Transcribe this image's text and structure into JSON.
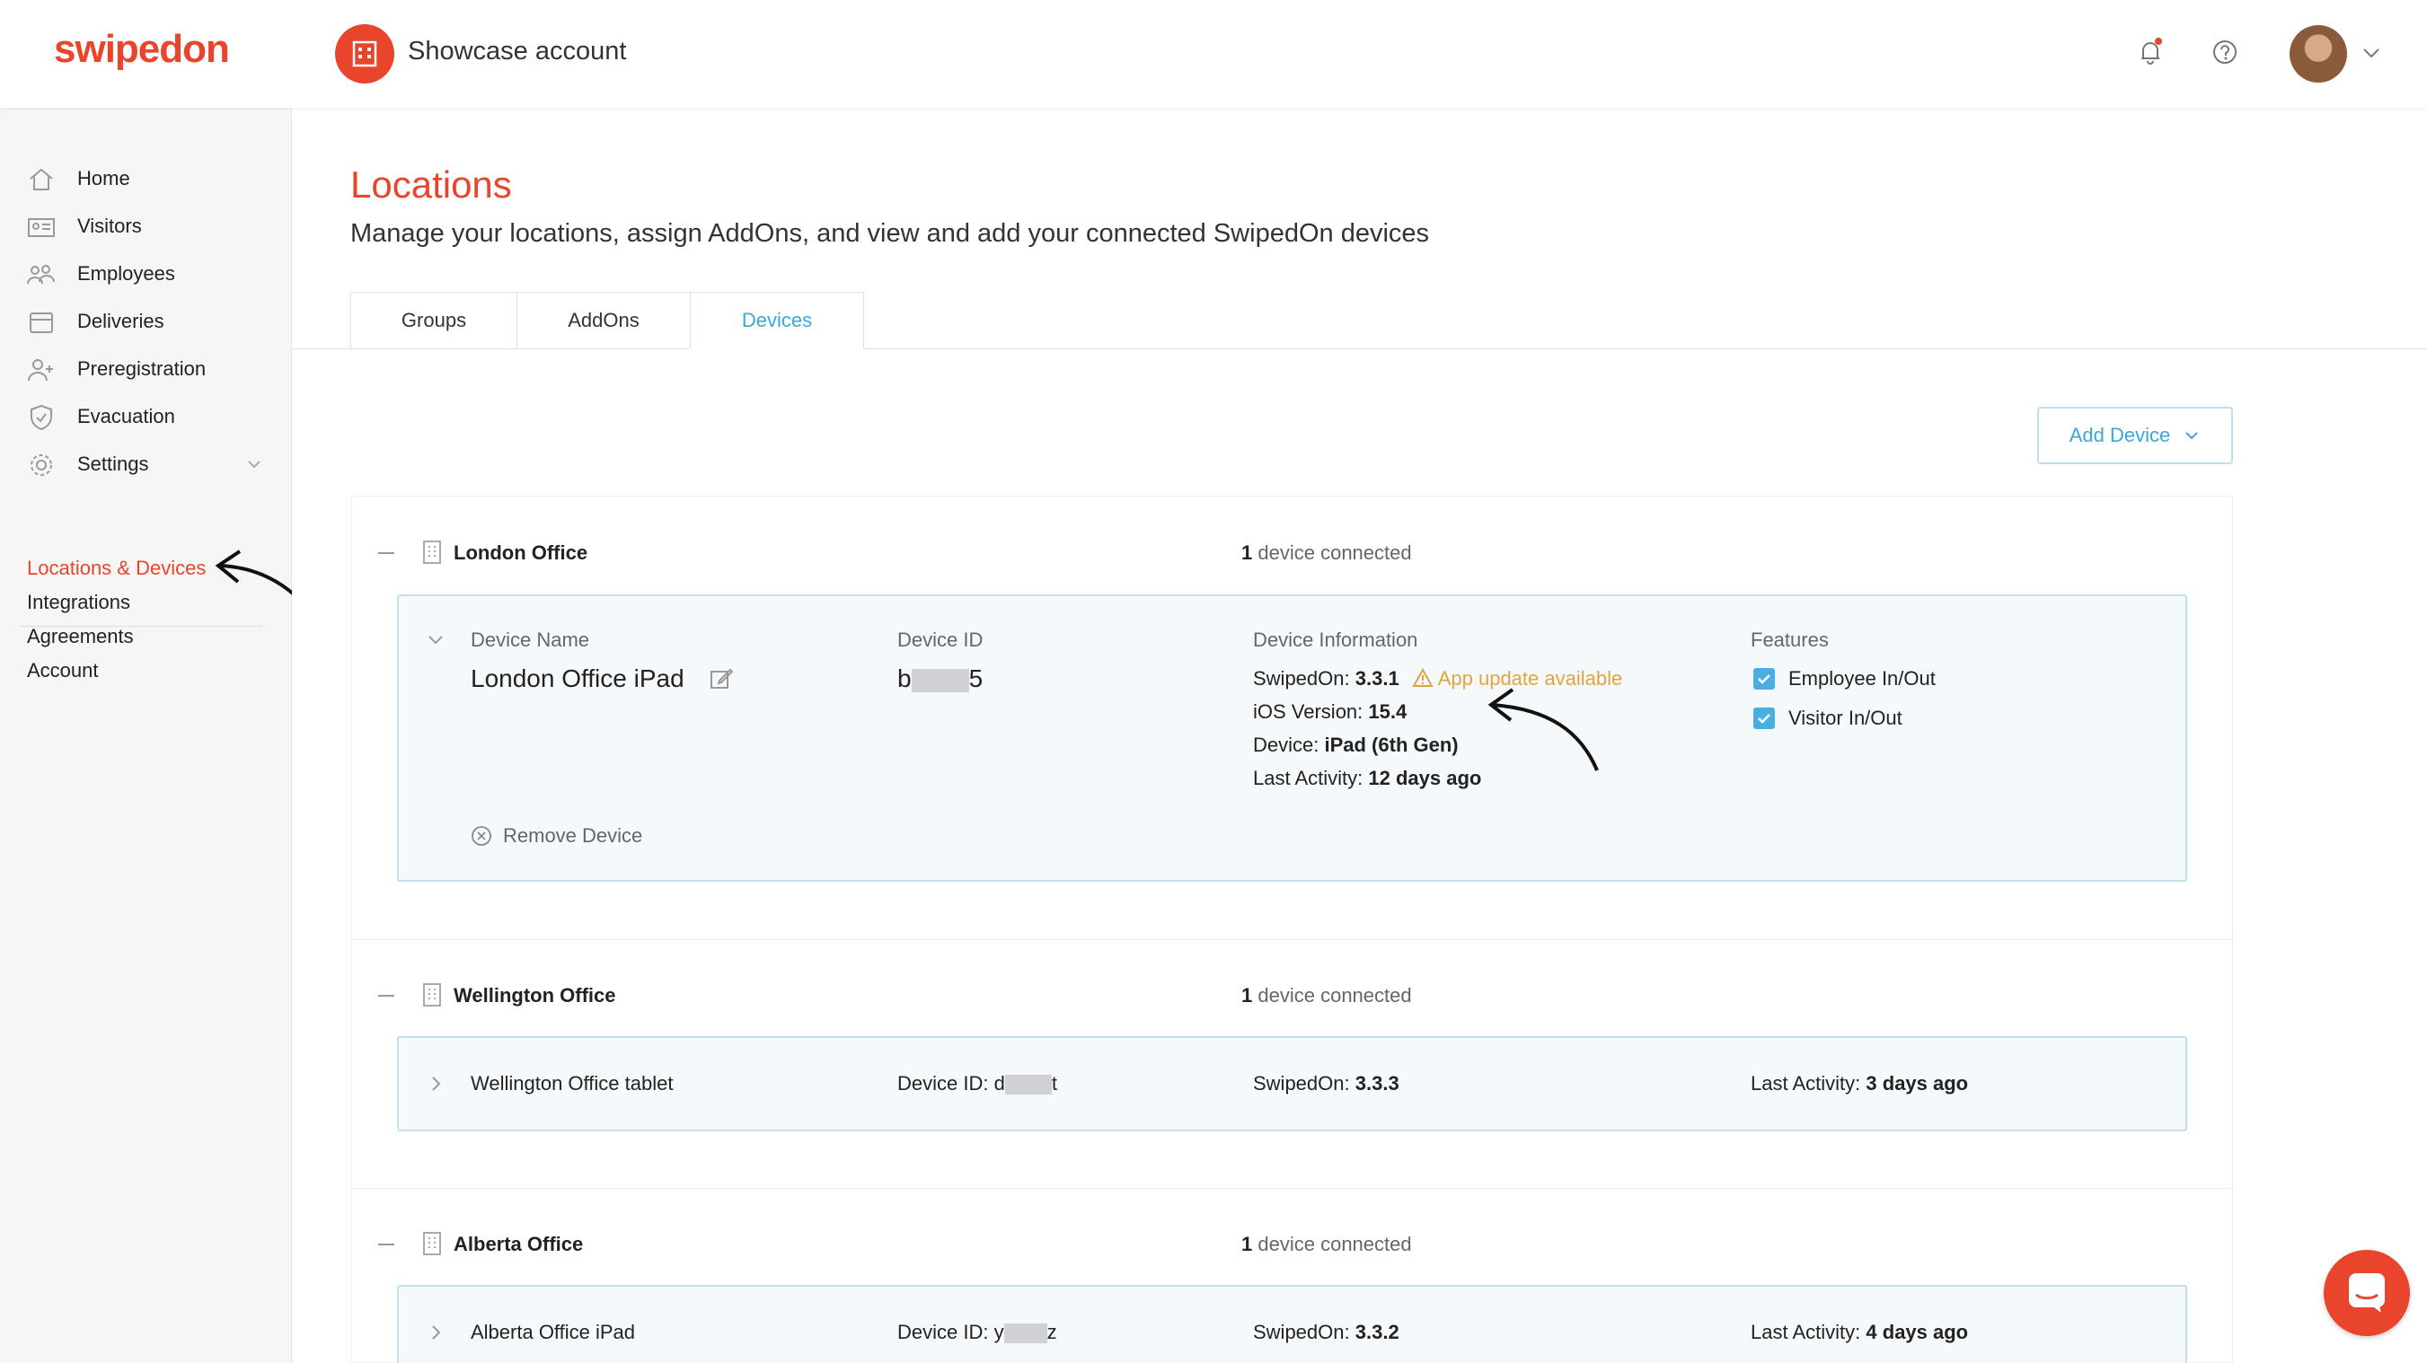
{
  "header": {
    "logo": "swipedon",
    "account_name": "Showcase account"
  },
  "sidebar": {
    "items": [
      {
        "label": "Home",
        "icon": "home-icon"
      },
      {
        "label": "Visitors",
        "icon": "id-card-icon"
      },
      {
        "label": "Employees",
        "icon": "people-icon"
      },
      {
        "label": "Deliveries",
        "icon": "box-icon"
      },
      {
        "label": "Preregistration",
        "icon": "user-plus-icon"
      },
      {
        "label": "Evacuation",
        "icon": "shield-icon"
      },
      {
        "label": "Settings",
        "icon": "gear-icon"
      }
    ],
    "links": [
      {
        "label": "Locations & Devices",
        "active": true
      },
      {
        "label": "Integrations"
      },
      {
        "label": "Agreements"
      },
      {
        "label": "Account"
      }
    ]
  },
  "page": {
    "title": "Locations",
    "subtitle": "Manage your locations, assign AddOns, and view and add your connected SwipedOn devices",
    "tabs": [
      "Groups",
      "AddOns",
      "Devices"
    ],
    "active_tab": "Devices",
    "add_device_label": "Add Device"
  },
  "locations": [
    {
      "name": "London Office",
      "count": "1",
      "count_suffix": "device connected",
      "device": {
        "label_name": "Device Name",
        "name": "London Office iPad",
        "label_id": "Device ID",
        "id_start": "b",
        "id_end": "5",
        "label_info": "Device Information",
        "swipedon_label": "SwipedOn:",
        "swipedon_value": "3.3.1",
        "update_notice": "App update available",
        "ios_label": "iOS Version:",
        "ios_value": "15.4",
        "device_label": "Device:",
        "device_value": "iPad (6th Gen)",
        "activity_label": "Last Activity:",
        "activity_value": "12 days ago",
        "label_features": "Features",
        "features": [
          "Employee In/Out",
          "Visitor In/Out"
        ],
        "remove_label": "Remove Device"
      }
    },
    {
      "name": "Wellington Office",
      "count": "1",
      "count_suffix": "device connected",
      "device": {
        "name": "Wellington Office tablet",
        "id_label": "Device ID:",
        "id_start": "d",
        "id_end": "t",
        "swipedon_label": "SwipedOn:",
        "swipedon_value": "3.3.3",
        "activity_label": "Last Activity:",
        "activity_value": "3 days ago"
      }
    },
    {
      "name": "Alberta Office",
      "count": "1",
      "count_suffix": "device connected",
      "device": {
        "name": "Alberta Office iPad",
        "id_label": "Device ID:",
        "id_start": "y",
        "id_end": "z",
        "swipedon_label": "SwipedOn:",
        "swipedon_value": "3.3.2",
        "activity_label": "Last Activity:",
        "activity_value": "4 days ago"
      }
    }
  ],
  "colors": {
    "brand": "#e8452c",
    "accent": "#3ba7d9",
    "warning": "#e3a43c"
  }
}
